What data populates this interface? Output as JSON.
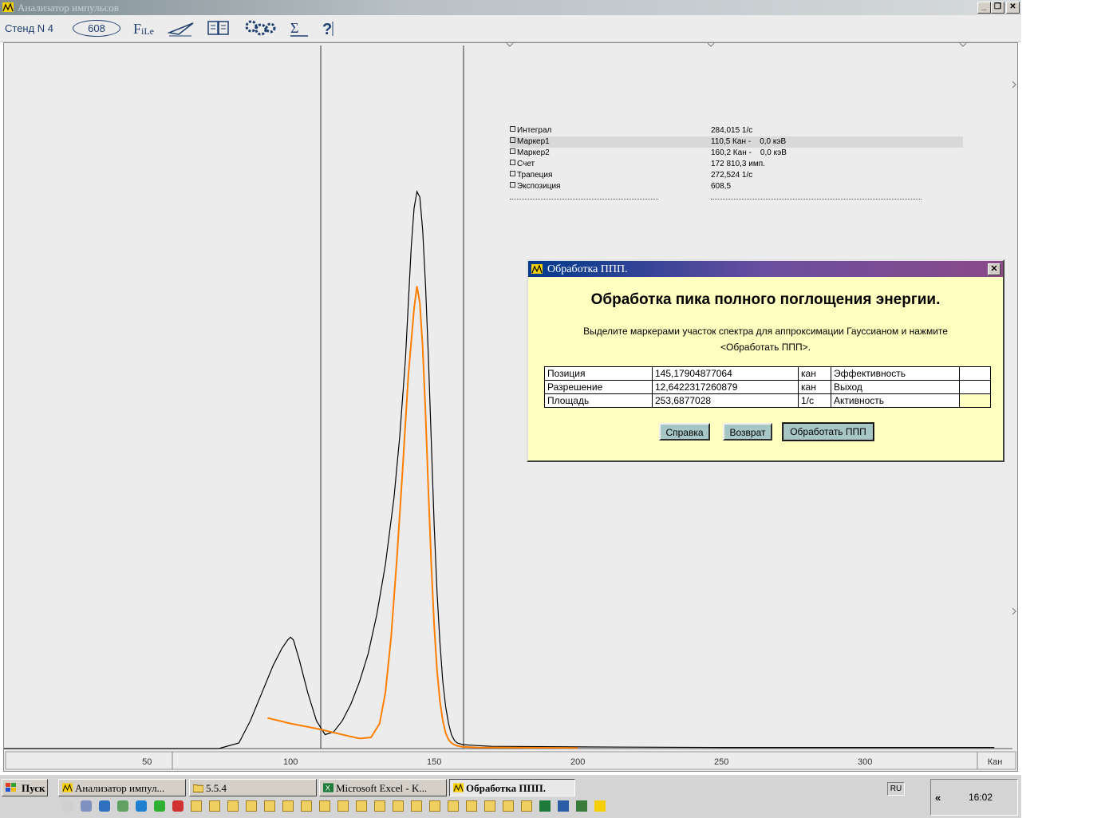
{
  "window": {
    "title": "Анализатор импульсов",
    "controls": [
      "minimize-button",
      "restore-button",
      "close-button"
    ]
  },
  "toolbar": {
    "stand_label": "Стенд N 4",
    "counter_value": "608",
    "icons": [
      "file-icon",
      "paper-plane-icon",
      "book-icon",
      "gears-icon",
      "sum-icon",
      "help-icon"
    ]
  },
  "stats": {
    "rows": [
      {
        "label": "Интеграл",
        "value": "284,015 1/c"
      },
      {
        "label": "Маркер1",
        "value": "110,5 Кан -    0,0 кэВ"
      },
      {
        "label": "Маркер2",
        "value": "160,2 Кан -    0,0 кэВ"
      },
      {
        "label": "Счет",
        "value": "172 810,3 имп."
      },
      {
        "label": "Трапеция",
        "value": "272,524 1/c"
      },
      {
        "label": "Экспозиция",
        "value": "608,5"
      }
    ]
  },
  "chart_data": {
    "type": "line",
    "xlabel": "Кан",
    "xlim": [
      0,
      340
    ],
    "ylim": [
      0,
      1
    ],
    "xticks": [
      50,
      100,
      150,
      200,
      250,
      300
    ],
    "markers": [
      110.5,
      160.2
    ],
    "series": [
      {
        "color": "#000000",
        "x": [
          0,
          75,
          82,
          86,
          90,
          94,
          97,
          99,
          100,
          101,
          103,
          106,
          109,
          112,
          115,
          118,
          121,
          124,
          127,
          130,
          133,
          136,
          138,
          140,
          141,
          142,
          143,
          144,
          145,
          146,
          147,
          148,
          149,
          150,
          151,
          152,
          153,
          154,
          155,
          156,
          157,
          158,
          160,
          163,
          170,
          200,
          250,
          300,
          345
        ],
        "y": [
          0,
          0,
          0.01,
          0.05,
          0.1,
          0.15,
          0.18,
          0.195,
          0.2,
          0.195,
          0.16,
          0.1,
          0.05,
          0.025,
          0.03,
          0.05,
          0.08,
          0.12,
          0.17,
          0.24,
          0.33,
          0.45,
          0.56,
          0.7,
          0.8,
          0.9,
          0.97,
          1.0,
          0.99,
          0.93,
          0.83,
          0.7,
          0.55,
          0.4,
          0.28,
          0.19,
          0.12,
          0.075,
          0.045,
          0.025,
          0.015,
          0.01,
          0.007,
          0.006,
          0.004,
          0.003,
          0.002,
          0.002,
          0.002
        ]
      },
      {
        "color": "#ff7f00",
        "x": [
          92,
          100,
          110,
          118,
          124,
          128,
          131,
          133,
          135,
          137,
          139,
          141,
          143,
          144,
          145,
          146,
          147,
          148,
          149,
          150,
          151,
          152,
          153,
          154,
          155,
          156,
          157,
          158,
          160,
          165,
          200
        ],
        "y": [
          0.055,
          0.045,
          0.035,
          0.025,
          0.018,
          0.02,
          0.045,
          0.1,
          0.2,
          0.34,
          0.5,
          0.67,
          0.79,
          0.83,
          0.8,
          0.72,
          0.6,
          0.46,
          0.33,
          0.22,
          0.14,
          0.085,
          0.05,
          0.028,
          0.016,
          0.01,
          0.007,
          0.005,
          0.003,
          0.002,
          0.001
        ]
      }
    ]
  },
  "dialog": {
    "title": "Обработка ППП.",
    "heading": "Обработка пика полного поглощения энергии.",
    "instruction_line1": "Выделите маркерами участок спектра для аппроксимации Гауссианом и нажмите",
    "instruction_line2": "<Обработать ППП>.",
    "table": [
      {
        "param": "Позиция",
        "value": "145,17904877064",
        "unit": "кан",
        "result": "Эффективность",
        "result_value": ""
      },
      {
        "param": "Разрешение",
        "value": "12,6422317260879",
        "unit": "кан",
        "result": "Выход",
        "result_value": ""
      },
      {
        "param": "Площадь",
        "value": "253,6877028",
        "unit": "1/c",
        "result": "Активность",
        "result_value": ""
      }
    ],
    "buttons": {
      "help": "Справка",
      "back": "Возврат",
      "process": "Обработать ППП"
    }
  },
  "taskbar": {
    "start": "Пуск",
    "tasks": [
      {
        "label": "Анализатор импул...",
        "icon": "analyzer-icon"
      },
      {
        "label": "5.5.4",
        "icon": "folder-icon"
      },
      {
        "label": "Microsoft Excel - K...",
        "icon": "excel-icon"
      },
      {
        "label": "Обработка ППП.",
        "icon": "analyzer-icon",
        "active": true
      }
    ],
    "lang": "RU",
    "tray_arrow": "«",
    "clock": "16:02"
  }
}
